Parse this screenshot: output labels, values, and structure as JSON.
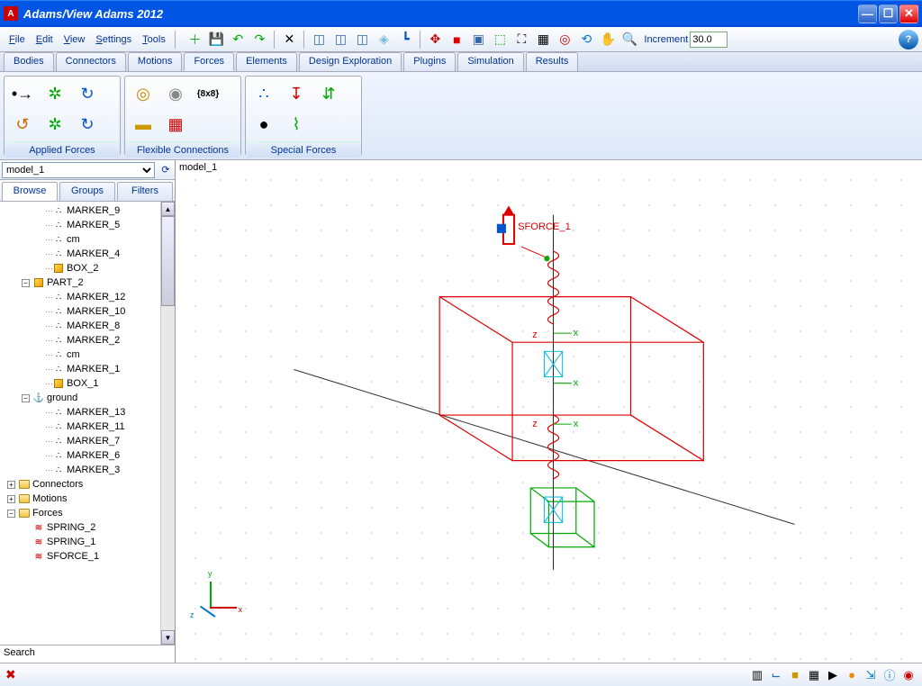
{
  "title": "Adams/View Adams 2012",
  "menus": {
    "file": "File",
    "edit": "Edit",
    "view": "View",
    "settings": "Settings",
    "tools": "Tools"
  },
  "increment": {
    "label": "Increment",
    "value": "30.0"
  },
  "tabs": {
    "bodies": "Bodies",
    "connectors": "Connectors",
    "motions": "Motions",
    "forces": "Forces",
    "elements": "Elements",
    "design": "Design Exploration",
    "plugins": "Plugins",
    "simulation": "Simulation",
    "results": "Results"
  },
  "ribbon_groups": {
    "applied": "Applied Forces",
    "flexible": "Flexible Connections",
    "special": "Special Forces"
  },
  "ribbon_matrix_label": "{8x8}",
  "model_name": "model_1",
  "tree_tabs": {
    "browse": "Browse",
    "groups": "Groups",
    "filters": "Filters"
  },
  "tree": {
    "m9": "MARKER_9",
    "m5": "MARKER_5",
    "cm1": "cm",
    "m4": "MARKER_4",
    "box2": "BOX_2",
    "part2": "PART_2",
    "m12": "MARKER_12",
    "m10": "MARKER_10",
    "m8": "MARKER_8",
    "m2": "MARKER_2",
    "cm2": "cm",
    "m1": "MARKER_1",
    "box1": "BOX_1",
    "ground": "ground",
    "m13": "MARKER_13",
    "m11": "MARKER_11",
    "m7": "MARKER_7",
    "m6": "MARKER_6",
    "m3": "MARKER_3",
    "connectors": "Connectors",
    "motions": "Motions",
    "forces": "Forces",
    "spring2": "SPRING_2",
    "spring1": "SPRING_1",
    "sforce1": "SFORCE_1"
  },
  "search": "Search",
  "view_label": "model_1",
  "scene": {
    "sforce_label": "SFORCE_1"
  },
  "axis": {
    "x": "x",
    "y": "y",
    "z": "z"
  }
}
